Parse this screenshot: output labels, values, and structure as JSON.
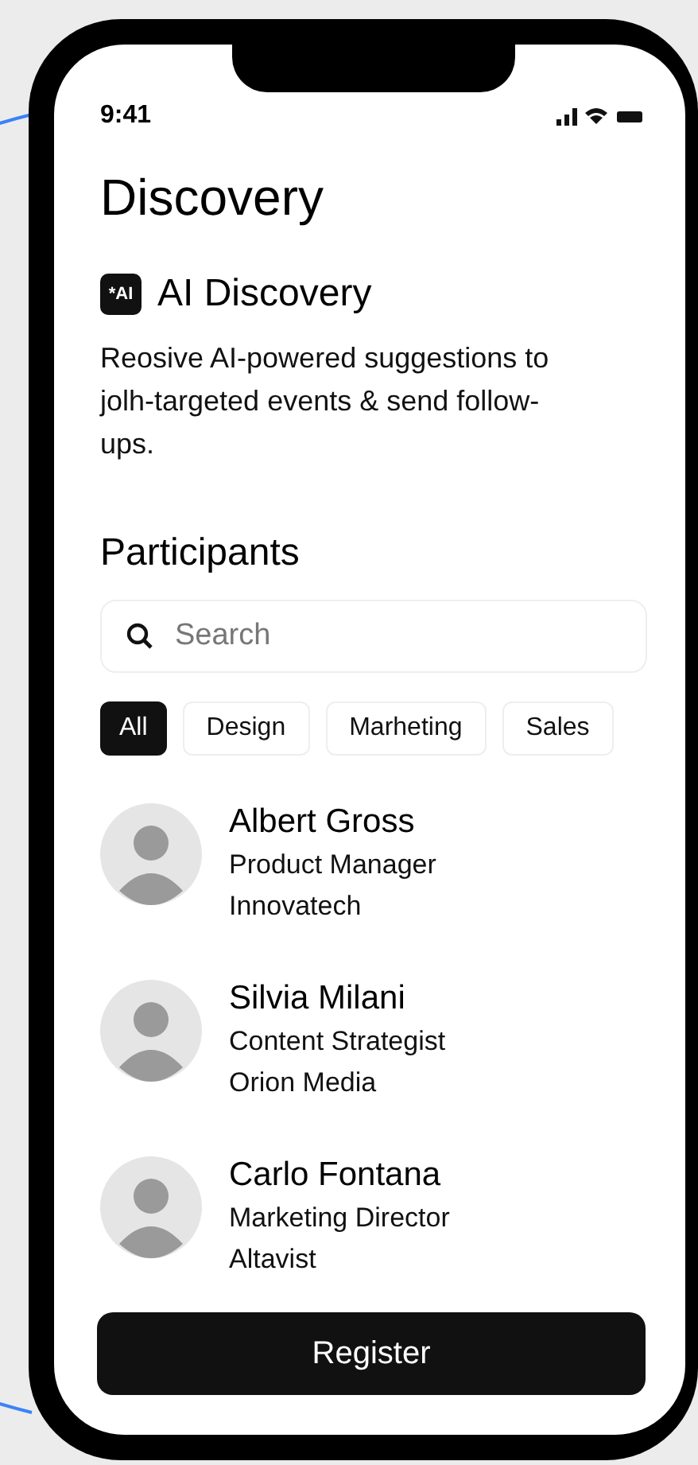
{
  "status_bar": {
    "time": "9:41"
  },
  "title": "Discovery",
  "ai_section": {
    "badge": "*AI",
    "heading": "AI Discovery",
    "description": "Reosive AI-powered suggestions to jolh-targeted events & send follow-ups."
  },
  "participants": {
    "heading": "Participants",
    "search": {
      "placeholder": "Search"
    },
    "filters": [
      {
        "label": "All",
        "selected": true
      },
      {
        "label": "Design",
        "selected": false
      },
      {
        "label": "Marheting",
        "selected": false
      },
      {
        "label": "Sales",
        "selected": false
      }
    ],
    "people": [
      {
        "name": "Albert Gross",
        "role": "Product Manager",
        "company": "Innovatech"
      },
      {
        "name": "Silvia Milani",
        "role": "Content Strategist",
        "company": "Orion Media"
      },
      {
        "name": "Carlo Fontana",
        "role": "Marketing Director",
        "company": "Altavist"
      }
    ]
  },
  "primary_button": "Register"
}
